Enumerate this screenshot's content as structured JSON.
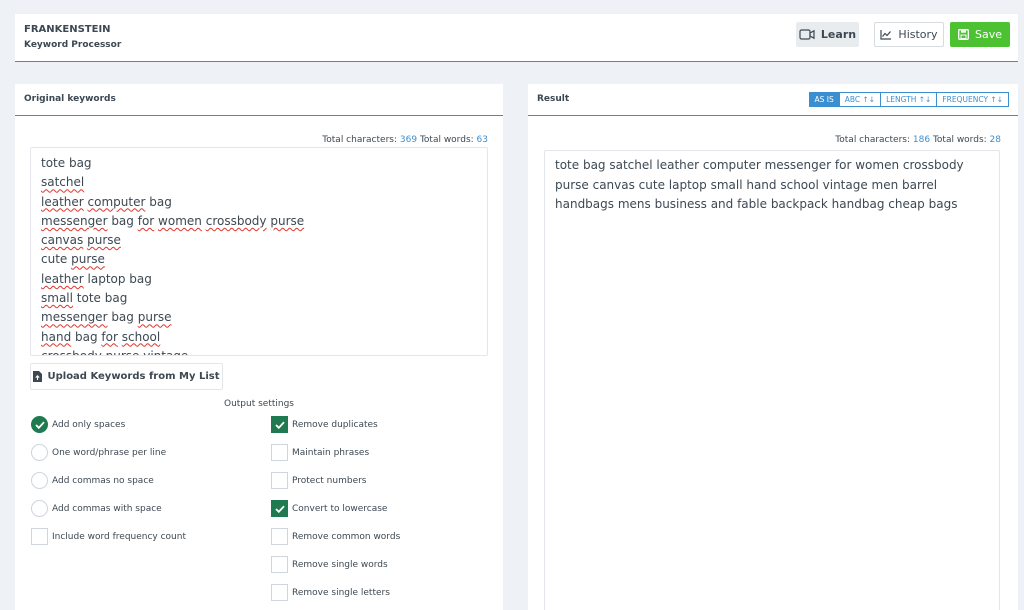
{
  "header": {
    "app_title": "FRANKENSTEIN",
    "app_subtitle": "Keyword Processor",
    "learn_label": "Learn",
    "history_label": "History",
    "save_label": "Save"
  },
  "left_panel": {
    "title": "Original keywords",
    "stats_chars_label": "Total characters:",
    "stats_chars": "369",
    "stats_words_label": "Total words:",
    "stats_words": "63",
    "keywords": [
      [
        {
          "t": "tote bag",
          "s": false
        }
      ],
      [
        {
          "t": "satchel",
          "s": true
        }
      ],
      [
        {
          "t": "leather",
          "s": true
        },
        {
          "t": " ",
          "s": false
        },
        {
          "t": "computer",
          "s": true
        },
        {
          "t": " bag",
          "s": false
        }
      ],
      [
        {
          "t": "messenger",
          "s": true
        },
        {
          "t": " bag ",
          "s": false
        },
        {
          "t": "for",
          "s": true
        },
        {
          "t": " ",
          "s": false
        },
        {
          "t": "women",
          "s": true
        },
        {
          "t": " ",
          "s": false
        },
        {
          "t": "crossbody",
          "s": true
        },
        {
          "t": " ",
          "s": false
        },
        {
          "t": "purse",
          "s": true
        }
      ],
      [
        {
          "t": "canvas",
          "s": true
        },
        {
          "t": " ",
          "s": false
        },
        {
          "t": "purse",
          "s": true
        }
      ],
      [
        {
          "t": "cute ",
          "s": false
        },
        {
          "t": "purse",
          "s": true
        }
      ],
      [
        {
          "t": "leather",
          "s": true
        },
        {
          "t": " laptop bag",
          "s": false
        }
      ],
      [
        {
          "t": "small",
          "s": true
        },
        {
          "t": " tote bag",
          "s": false
        }
      ],
      [
        {
          "t": "messenger",
          "s": true
        },
        {
          "t": " bag ",
          "s": false
        },
        {
          "t": "purse",
          "s": true
        }
      ],
      [
        {
          "t": "hand",
          "s": true
        },
        {
          "t": " bag ",
          "s": false
        },
        {
          "t": "for",
          "s": true
        },
        {
          "t": " ",
          "s": false
        },
        {
          "t": "school",
          "s": true
        }
      ],
      [
        {
          "t": "crossbody purse vintage",
          "s": false
        }
      ]
    ],
    "upload_label": "Upload Keywords from My List",
    "output_settings_label": "Output settings",
    "radio_options": [
      {
        "label": "Add only spaces",
        "checked": true
      },
      {
        "label": "One word/phrase per line",
        "checked": false
      },
      {
        "label": "Add commas no space",
        "checked": false
      },
      {
        "label": "Add commas with space",
        "checked": false
      }
    ],
    "frequency_option": {
      "label": "Include word frequency count",
      "checked": false
    },
    "checkbox_options": [
      {
        "label": "Remove duplicates",
        "checked": true
      },
      {
        "label": "Maintain phrases",
        "checked": false
      },
      {
        "label": "Protect numbers",
        "checked": false
      },
      {
        "label": "Convert to lowercase",
        "checked": true
      },
      {
        "label": "Remove common words",
        "checked": false
      },
      {
        "label": "Remove single words",
        "checked": false
      },
      {
        "label": "Remove single letters",
        "checked": false
      }
    ]
  },
  "right_panel": {
    "title": "Result",
    "sort_buttons": [
      {
        "label": "AS IS",
        "active": true
      },
      {
        "label": "ABC ↑↓",
        "active": false
      },
      {
        "label": "LENGTH ↑↓",
        "active": false
      },
      {
        "label": "FREQUENCY ↑↓",
        "active": false
      }
    ],
    "stats_chars_label": "Total characters:",
    "stats_chars": "186",
    "stats_words_label": "Total words:",
    "stats_words": "28",
    "result_text": "tote bag satchel leather computer messenger for women crossbody purse canvas cute laptop small hand school vintage men barrel handbags mens business and fable backpack handbag cheap bags"
  },
  "colors": {
    "accent": "#3b8fd0",
    "save_green": "#4cc232",
    "check_green": "#1f7a4f"
  }
}
